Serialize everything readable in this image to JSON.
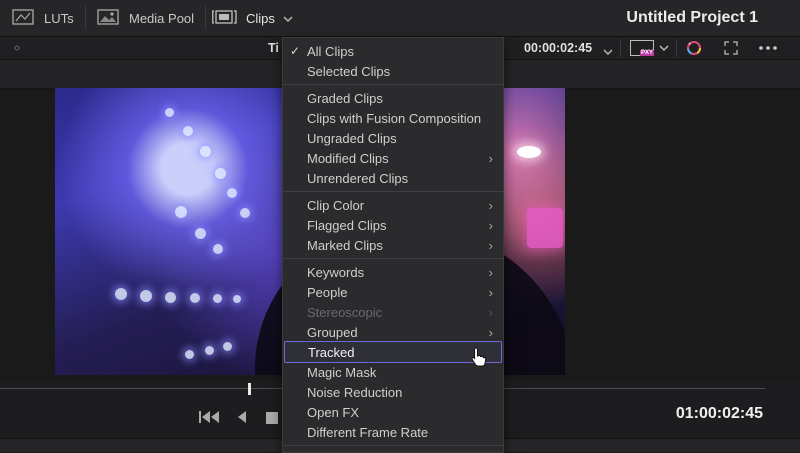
{
  "topbar": {
    "luts_label": "LUTs",
    "media_pool_label": "Media Pool",
    "clips_label": "Clips",
    "project_title": "Untitled Project 1"
  },
  "viewer": {
    "timeline_label_partial": "Ti",
    "timecode": "00:00:02:45",
    "proxy_badge": "PXY"
  },
  "transport": {
    "timecode": "01:00:02:45"
  },
  "menu": {
    "groups": [
      {
        "items": [
          {
            "label": "All Clips",
            "checked": true
          },
          {
            "label": "Selected Clips"
          }
        ]
      },
      {
        "items": [
          {
            "label": "Graded Clips"
          },
          {
            "label": "Clips with Fusion Composition"
          },
          {
            "label": "Ungraded Clips"
          },
          {
            "label": "Modified Clips",
            "submenu": true
          },
          {
            "label": "Unrendered Clips"
          }
        ]
      },
      {
        "items": [
          {
            "label": "Clip Color",
            "submenu": true
          },
          {
            "label": "Flagged Clips",
            "submenu": true
          },
          {
            "label": "Marked Clips",
            "submenu": true
          }
        ]
      },
      {
        "items": [
          {
            "label": "Keywords",
            "submenu": true
          },
          {
            "label": "People",
            "submenu": true
          },
          {
            "label": "Stereoscopic",
            "submenu": true,
            "disabled": true
          },
          {
            "label": "Grouped",
            "submenu": true
          },
          {
            "label": "Tracked",
            "highlighted": true
          },
          {
            "label": "Magic Mask"
          },
          {
            "label": "Noise Reduction"
          },
          {
            "label": "Open FX"
          },
          {
            "label": "Different Frame Rate"
          }
        ]
      }
    ]
  },
  "colors": {
    "highlight_border": "#6a6ad8",
    "menu_bg": "#2b2b2d",
    "proxy_badge_bg": "#b9399d"
  },
  "icons": [
    "luts-icon",
    "media-pool-icon",
    "clips-icon",
    "chevron-down-icon",
    "proxy-icon",
    "color-wheel-icon",
    "fullscreen-icon",
    "more-icon",
    "skip-back-icon",
    "play-reverse-icon",
    "stop-icon",
    "checkmark-icon",
    "chevron-right-icon",
    "pointer-cursor-icon"
  ]
}
